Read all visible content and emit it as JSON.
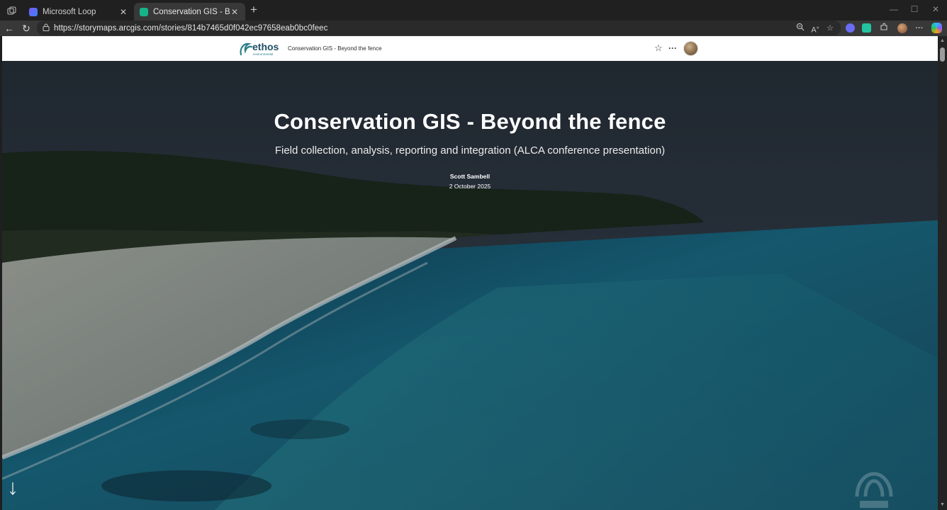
{
  "browser": {
    "tabs": [
      {
        "title": "Microsoft Loop",
        "favicon_color": "#7a5af8"
      },
      {
        "title": "Conservation GIS - Beyond the fe",
        "favicon_color": "#18b28a"
      }
    ],
    "url": "https://storymaps.arcgis.com/stories/814b7465d0f042ec97658eab0bc0feec",
    "icons": [
      "tab-actions-icon",
      "close-icon",
      "plus-icon",
      "minimize-icon",
      "maximize-icon",
      "back-icon",
      "refresh-icon",
      "lock-icon",
      "zoom-icon",
      "read-aloud-icon",
      "favorite-star-icon",
      "extensions-icon",
      "more-icon",
      "copilot-icon"
    ]
  },
  "storymap": {
    "header": {
      "logo_text": "ethos",
      "logo_subtext": "environmental",
      "title": "Conservation GIS - Beyond the fence"
    },
    "hero": {
      "title": "Conservation GIS - Beyond the fence",
      "subtitle": "Field collection, analysis, reporting and integration (ALCA conference presentation)",
      "author": "Scott Sambell",
      "date": "2 October 2025"
    }
  },
  "colors": {
    "chrome_dark": "#202020",
    "toolbar": "#383838",
    "ocean": "#1f6f86",
    "sand": "#9aa49e"
  }
}
